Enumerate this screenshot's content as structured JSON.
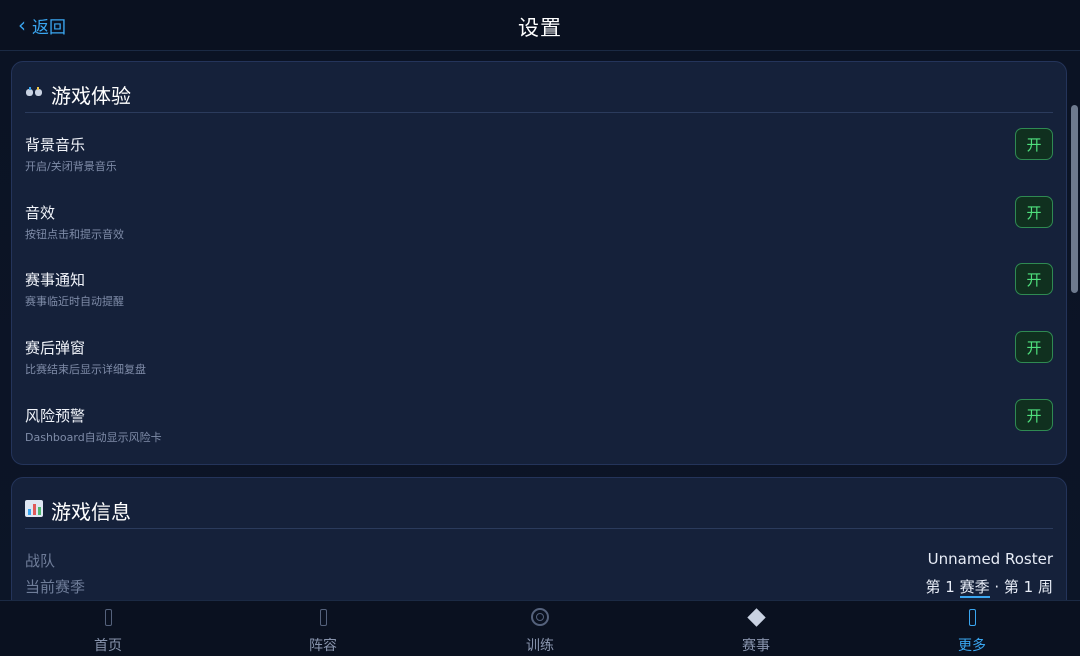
{
  "header": {
    "back_label": "返回",
    "title": "设置"
  },
  "experience": {
    "title": "游戏体验",
    "icon": "gamepad-icon",
    "rows": [
      {
        "label": "背景音乐",
        "desc": "开启/关闭背景音乐",
        "toggle": "开"
      },
      {
        "label": "音效",
        "desc": "按钮点击和提示音效",
        "toggle": "开"
      },
      {
        "label": "赛事通知",
        "desc": "赛事临近时自动提醒",
        "toggle": "开"
      },
      {
        "label": "赛后弹窗",
        "desc": "比赛结束后显示详细复盘",
        "toggle": "开"
      },
      {
        "label": "风险预警",
        "desc": "Dashboard自动显示风险卡",
        "toggle": "开"
      }
    ]
  },
  "info": {
    "title": "游戏信息",
    "icon": "bar-chart-icon",
    "team_label": "战队",
    "team_value": "Unnamed Roster",
    "season_label": "当前赛季",
    "season_value_a": "第 1 ",
    "season_value_b": "赛季",
    "season_value_c": " · 第 1 周"
  },
  "tabs": [
    {
      "label": "首页",
      "icon": "home-icon"
    },
    {
      "label": "阵容",
      "icon": "roster-icon"
    },
    {
      "label": "训练",
      "icon": "target-icon"
    },
    {
      "label": "赛事",
      "icon": "diamond-icon"
    },
    {
      "label": "更多",
      "icon": "more-icon",
      "active": true
    }
  ],
  "colors": {
    "accent": "#3aa6f0",
    "toggle_on": "#4fe07d",
    "card_bg": "#15213a",
    "page_bg": "#0b1222"
  }
}
